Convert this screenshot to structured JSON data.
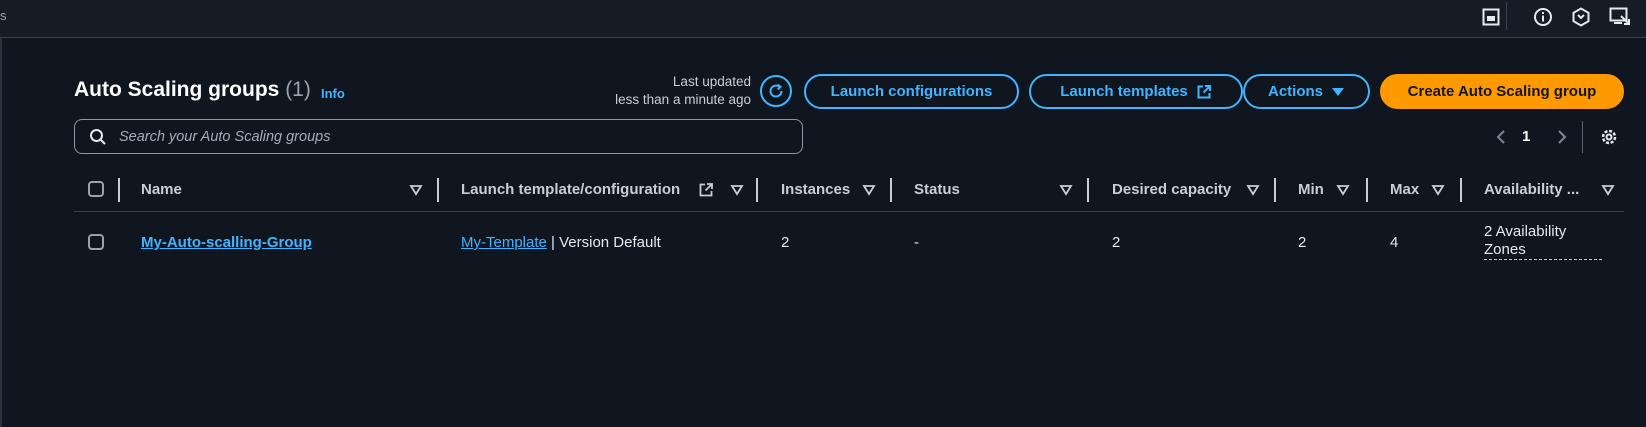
{
  "topbar": {
    "crumb": "s",
    "icons": [
      "panel-icon",
      "info-circle-icon",
      "hexagon-icon",
      "screen-share-icon"
    ]
  },
  "header": {
    "title": "Auto Scaling groups",
    "count": "(1)",
    "info": "Info",
    "last_updated_label": "Last updated",
    "last_updated_value": "less than a minute ago"
  },
  "buttons": {
    "launch_configurations": "Launch configurations",
    "launch_templates": "Launch templates",
    "actions": "Actions",
    "create": "Create Auto Scaling group"
  },
  "colors": {
    "accent": "#42b4ff",
    "primary": "#ff9900",
    "background": "#0f1620"
  },
  "search": {
    "placeholder": "Search your Auto Scaling groups",
    "value": ""
  },
  "pagination": {
    "current_page": "1"
  },
  "table": {
    "columns": [
      "Name",
      "Launch template/configuration",
      "Instances",
      "Status",
      "Desired capacity",
      "Min",
      "Max",
      "Availability ..."
    ],
    "rows": [
      {
        "name": "My-Auto-scalling-Group",
        "template_link": "My-Template",
        "template_rest": " | Version Default",
        "instances": "2",
        "status": "-",
        "desired": "2",
        "min": "2",
        "max": "4",
        "availability_line1": "2 Availability",
        "availability_line2": "Zones"
      }
    ]
  }
}
